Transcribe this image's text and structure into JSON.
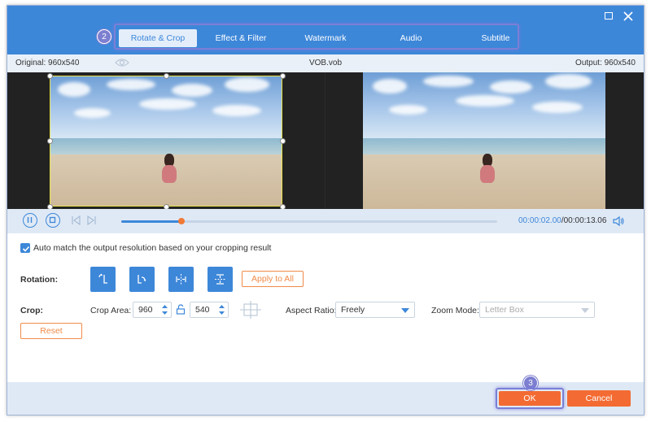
{
  "tabs": [
    {
      "label": "Rotate & Crop",
      "active": true
    },
    {
      "label": "Effect & Filter",
      "active": false
    },
    {
      "label": "Watermark",
      "active": false
    },
    {
      "label": "Audio",
      "active": false
    },
    {
      "label": "Subtitle",
      "active": false
    }
  ],
  "step_badges": {
    "tabs": "2",
    "ok": "3"
  },
  "info": {
    "original": "Original: 960x540",
    "filename": "VOB.vob",
    "output": "Output: 960x540"
  },
  "playback": {
    "current_time": "00:00:02.00",
    "total_time": "/00:00:13.06",
    "progress": 0.16
  },
  "options": {
    "auto_match_label": "Auto match the output resolution based on your cropping result",
    "auto_match_checked": true
  },
  "rotation": {
    "label": "Rotation:",
    "apply_all_label": "Apply to All",
    "buttons": [
      "rotate-left",
      "rotate-right",
      "flip-horizontal",
      "flip-vertical"
    ]
  },
  "crop": {
    "label": "Crop:",
    "area_label": "Crop Area:",
    "width": "960",
    "height": "540",
    "aspect_label": "Aspect Ratio:",
    "aspect_value": "Freely",
    "zoom_label": "Zoom Mode:",
    "zoom_value": "Letter Box",
    "reset_label": "Reset"
  },
  "footer": {
    "ok_label": "OK",
    "cancel_label": "Cancel"
  },
  "colors": {
    "accent": "#3d87d9",
    "orange": "#f36b32",
    "highlight": "#7b7fd6"
  }
}
